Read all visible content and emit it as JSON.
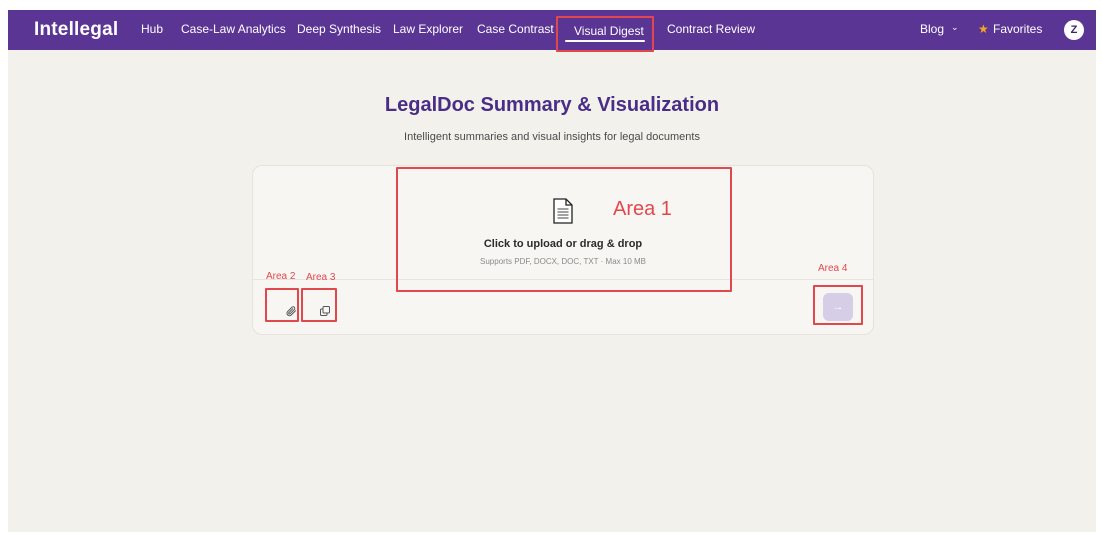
{
  "nav": {
    "brand": "Intellegal",
    "links": [
      "Hub",
      "Case-Law Analytics",
      "Deep Synthesis",
      "Law Explorer",
      "Case Contrast",
      "Visual Digest",
      "Contract Review"
    ],
    "active": "Visual Digest",
    "blog": "Blog",
    "favorites": "Favorites",
    "avatar_initial": "Z"
  },
  "hero": {
    "title": "LegalDoc Summary & Visualization",
    "subtitle": "Intelligent summaries and visual insights for legal documents"
  },
  "upload": {
    "title": "Click to upload or drag & drop",
    "hint": "Supports PDF, DOCX, DOC, TXT · Max 10 MB"
  },
  "annotations": {
    "area1": "Area 1",
    "area2": "Area 2",
    "area3": "Area 3",
    "area4": "Area 4"
  },
  "colors": {
    "nav_bg": "#5b3594",
    "title": "#4a2d86",
    "annotation": "#e1484d",
    "favorite_star": "#f5a623",
    "send_button": "#d6cde6"
  }
}
